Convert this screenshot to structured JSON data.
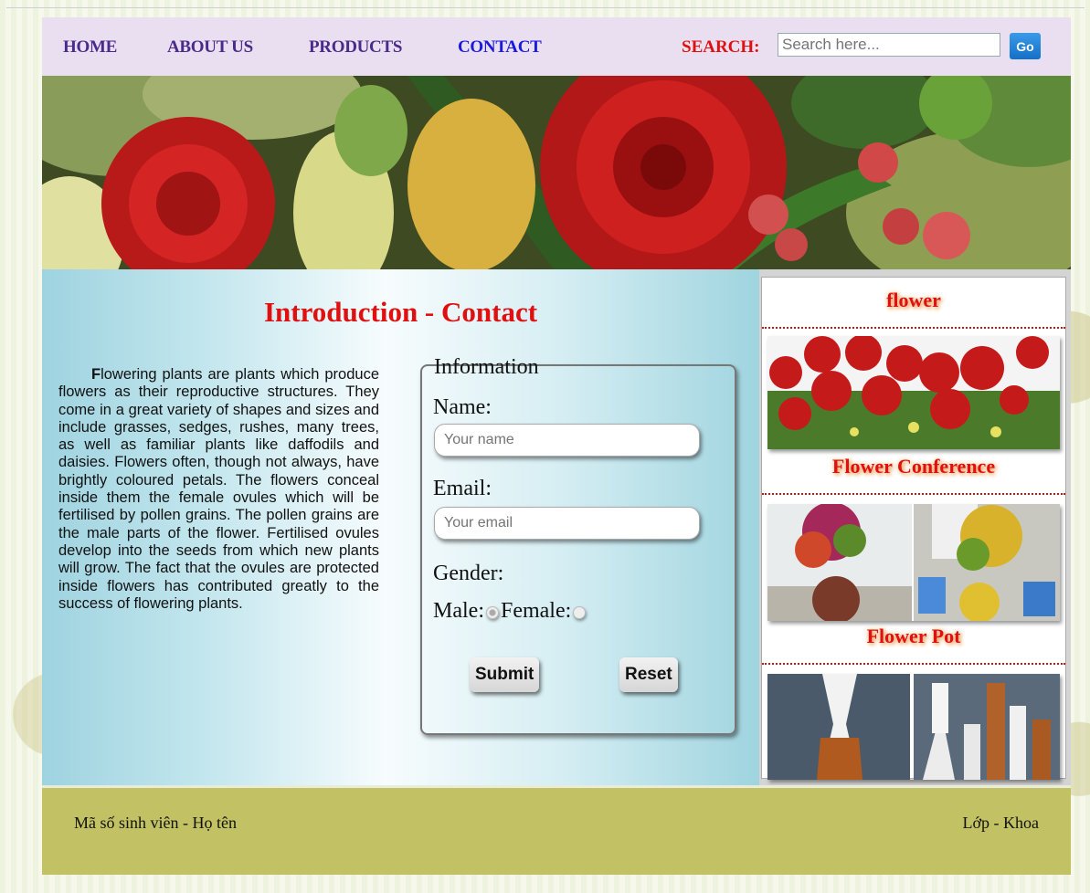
{
  "nav": {
    "items": [
      {
        "label": "HOME"
      },
      {
        "label": "ABOUT US"
      },
      {
        "label": "PRODUCTS"
      },
      {
        "label": "CONTACT"
      }
    ],
    "search_label": "SEARCH:",
    "search_placeholder": "Search here...",
    "go_label": "Go"
  },
  "main": {
    "title": "Introduction - Contact",
    "intro_first_letter": "F",
    "intro_text": "lowering plants are plants which produce flowers as their reproductive structures. They come in a great variety of shapes and sizes and include grasses, sedges, rushes, many trees, as well as familiar plants like daffodils and daisies. Flowers often, though not always, have brightly coloured petals. The flowers conceal inside them the female ovules which will be fertilised by pollen grains. The pollen grains are the male parts of the flower. Fertilised ovules develop into the seeds from which new plants will grow. The fact that the ovules are protected inside flowers has contributed greatly to the success of flowering plants."
  },
  "form": {
    "legend": "Information",
    "name_label": "Name:",
    "name_placeholder": "Your name",
    "email_label": "Email:",
    "email_placeholder": "Your email",
    "gender_label": "Gender:",
    "male_label": "Male:",
    "female_label": "Female:",
    "submit_label": "Submit",
    "reset_label": "Reset"
  },
  "sidebar": {
    "title": "flower",
    "captions": [
      "Flower Conference",
      "Flower Pot"
    ]
  },
  "footer": {
    "left": "Mã số sinh viên - Họ tên",
    "right": "Lớp - Khoa"
  },
  "colors": {
    "nav_bg": "#e9dff0",
    "nav_link": "#4a2a8a",
    "active_link": "#1a1adf",
    "accent_red": "#e01010",
    "footer_bg": "#c2c163"
  }
}
